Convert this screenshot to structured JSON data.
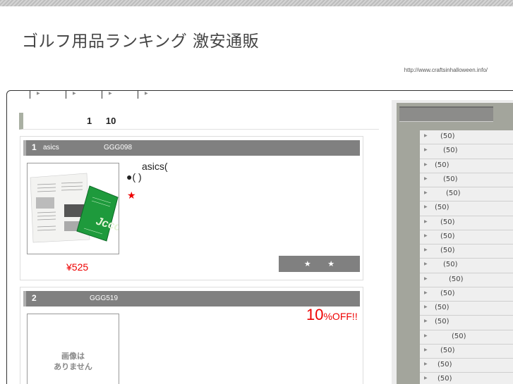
{
  "header": {
    "title": "ゴルフ用品ランキング 激安通販",
    "url": "http://www.craftsinhalloween.info/"
  },
  "nav": {
    "items": [
      "",
      "",
      "",
      ""
    ]
  },
  "section": {
    "heading": "1 10"
  },
  "items": [
    {
      "rank": "1",
      "brand": "asics",
      "code": "GGG098",
      "name": "asics(",
      "name_line2": "●( )",
      "star": "★",
      "price": "¥525",
      "review_label": "★ ★",
      "image_alt": "Jcco book",
      "image_cover_text": "Jcco"
    },
    {
      "rank": "2",
      "brand": "",
      "code": "GGG519",
      "discount_number": "10",
      "discount_suffix": "%OFF!!",
      "no_image_line1": "画像は",
      "no_image_line2": "ありません"
    }
  ],
  "sidebar": {
    "heading": "",
    "categories": [
      {
        "count": "(50)",
        "indent": 2
      },
      {
        "count": "(50)",
        "indent": 3
      },
      {
        "count": "(50)",
        "indent": 0
      },
      {
        "count": "(50)",
        "indent": 3
      },
      {
        "count": "(50)",
        "indent": 4
      },
      {
        "count": "(50)",
        "indent": 0
      },
      {
        "count": "(50)",
        "indent": 2
      },
      {
        "count": "(50)",
        "indent": 2
      },
      {
        "count": "(50)",
        "indent": 2
      },
      {
        "count": "(50)",
        "indent": 3
      },
      {
        "count": "(50)",
        "indent": 5
      },
      {
        "count": "(50)",
        "indent": 2
      },
      {
        "count": "(50)",
        "indent": 0
      },
      {
        "count": "(50)",
        "indent": 0
      },
      {
        "count": "(50)",
        "indent": 6
      },
      {
        "count": "(50)",
        "indent": 2
      },
      {
        "count": "(50)",
        "indent": 1
      },
      {
        "count": "(50)",
        "indent": 1
      }
    ]
  },
  "colors": {
    "accent_red": "#ee0000",
    "bar_gray": "#808080"
  }
}
